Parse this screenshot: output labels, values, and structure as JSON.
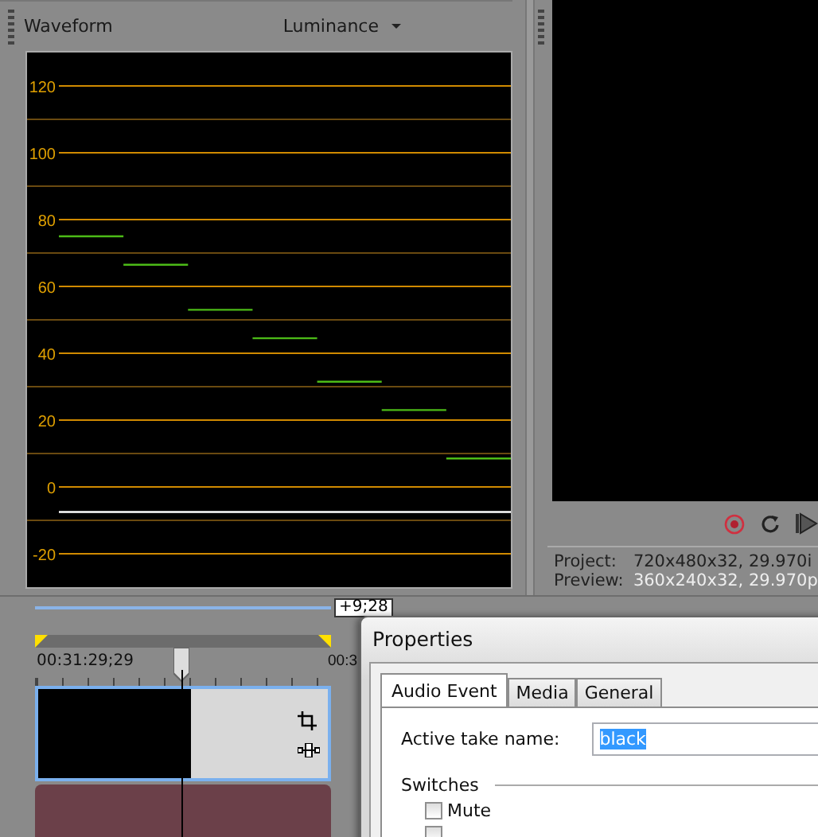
{
  "waveform": {
    "title": "Waveform",
    "mode": "Luminance",
    "scale_labels": [
      "120",
      "100",
      "80",
      "60",
      "40",
      "20",
      "0",
      "-20"
    ]
  },
  "preview": {
    "project_label": "Project:",
    "project_value": "720x480x32, 29.970i",
    "preview_label": "Preview:",
    "preview_value": "360x240x32, 29.970p"
  },
  "timeline": {
    "offset": "+9;28",
    "time_start": "00:31:29;29",
    "time_end": "00:3"
  },
  "properties": {
    "title": "Properties",
    "tabs": [
      {
        "label": "Audio Event",
        "selected": true
      },
      {
        "label": "Media",
        "selected": false
      },
      {
        "label": "General",
        "selected": false
      }
    ],
    "take_label": "Active take name:",
    "take_value": "black",
    "switches_label": "Switches",
    "switches": [
      {
        "label": "Mute",
        "checked": false
      },
      {
        "checked": false
      }
    ]
  }
}
